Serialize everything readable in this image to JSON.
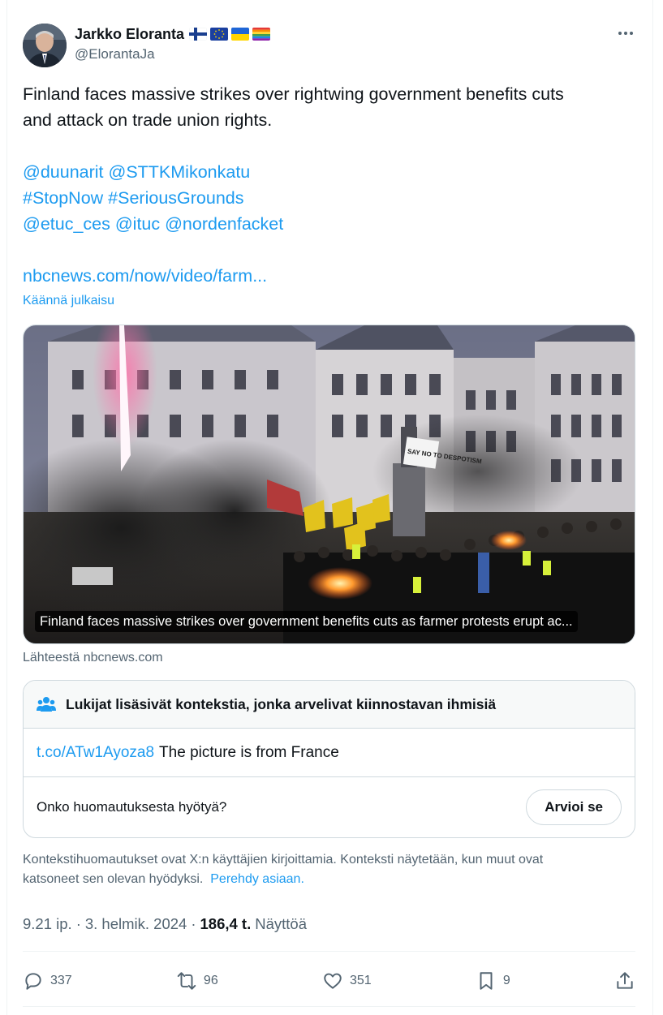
{
  "author": {
    "display_name": "Jarkko Eloranta",
    "handle": "@ElorantaJa",
    "flags": [
      "finland-flag-icon",
      "eu-flag-icon",
      "ukraine-flag-icon",
      "rainbow-flag-icon"
    ]
  },
  "more_menu": "more-icon",
  "tweet": {
    "line1": "Finland faces massive strikes over rightwing  government benefits cuts",
    "line2": "and  attack on trade union rights.",
    "mentions1": "@duunarit @STTKMikonkatu",
    "hashtags": "#StopNow #SeriousGrounds",
    "mentions2": "@etuc_ces @ituc @nordenfacket",
    "link": "nbcnews.com/now/video/farm..."
  },
  "translate_label": "Käännä julkaisu",
  "media": {
    "caption": "Finland faces massive strikes over government benefits cuts as farmer protests erupt ac...",
    "sign_text": "SAY NO TO DESPOTISM",
    "source": "Lähteestä nbcnews.com"
  },
  "community_note": {
    "header": "Lukijat lisäsivät kontekstia, jonka arvelivat kiinnostavan ihmisiä",
    "link": "t.co/ATw1Ayoza8",
    "text": "The picture is from France",
    "question": "Onko huomautuksesta hyötyä?",
    "rate_label": "Arvioi se"
  },
  "disclaimer": {
    "line1": "Kontekstihuomautukset ovat X:n käyttäjien kirjoittamia. Konteksti näytetään, kun muut ovat",
    "line2": "katsoneet sen olevan hyödyksi.",
    "learn_more": "Perehdy asiaan."
  },
  "meta": {
    "time": "9.21 ip.",
    "sep1": "·",
    "date": "3. helmik. 2024",
    "sep2": "·",
    "views_count": "186,4 t.",
    "views_label": "Näyttöä"
  },
  "actions": {
    "replies": "337",
    "reposts": "96",
    "likes": "351",
    "bookmarks": "9"
  },
  "colors": {
    "link": "#1d9bf0",
    "secondary_text": "#536471",
    "border": "#cfd9de"
  }
}
